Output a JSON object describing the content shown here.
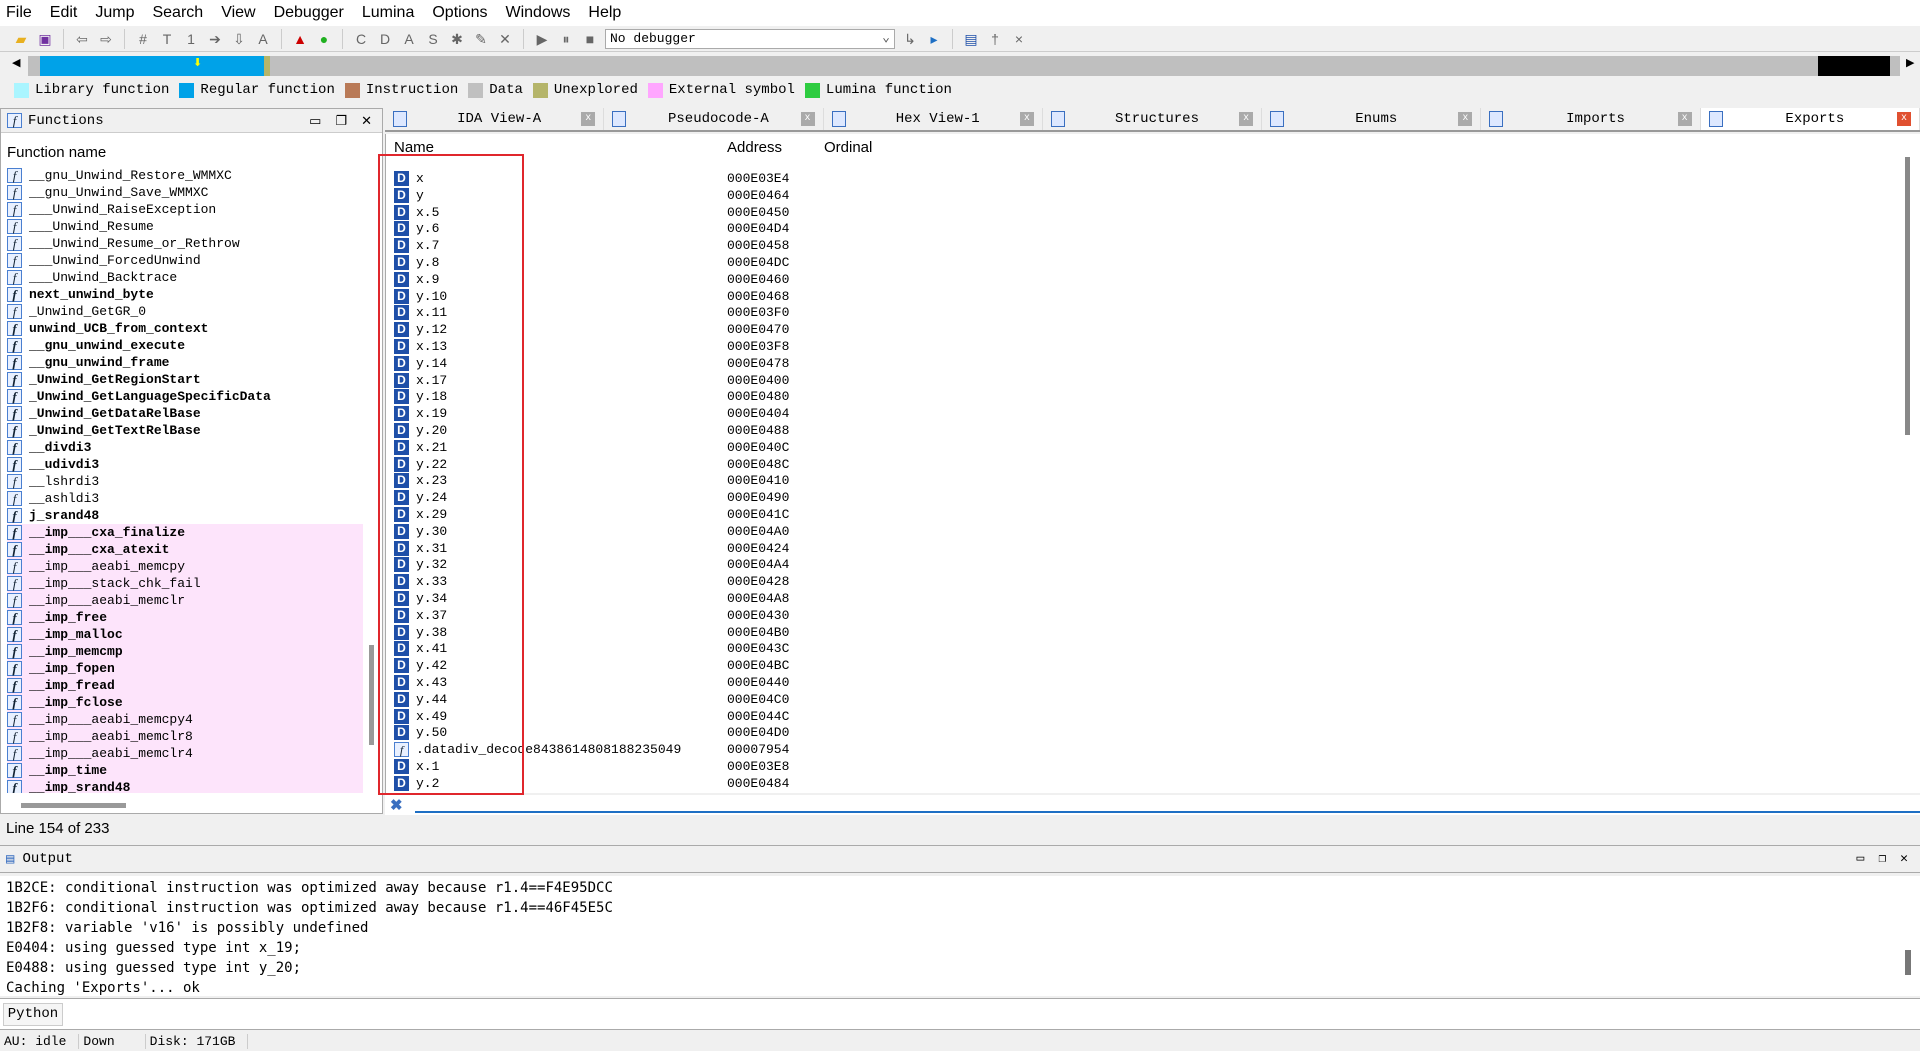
{
  "menu": [
    "File",
    "Edit",
    "Jump",
    "Search",
    "View",
    "Debugger",
    "Lumina",
    "Options",
    "Windows",
    "Help"
  ],
  "toolbar": {
    "debugger_select": "No debugger"
  },
  "legend": [
    {
      "label": "Library function",
      "color": "#aaf5ff"
    },
    {
      "label": "Regular function",
      "color": "#00a2e8"
    },
    {
      "label": "Instruction",
      "color": "#b97a57"
    },
    {
      "label": "Data",
      "color": "#c0c0c0"
    },
    {
      "label": "Unexplored",
      "color": "#b5b56a"
    },
    {
      "label": "External symbol",
      "color": "#ffa6ff"
    },
    {
      "label": "Lumina function",
      "color": "#2ecc40"
    }
  ],
  "functions": {
    "title": "Functions",
    "column": "Function name",
    "items": [
      {
        "name": "__gnu_Unwind_Restore_WMMXC"
      },
      {
        "name": "__gnu_Unwind_Save_WMMXC"
      },
      {
        "name": "___Unwind_RaiseException"
      },
      {
        "name": "___Unwind_Resume"
      },
      {
        "name": "___Unwind_Resume_or_Rethrow"
      },
      {
        "name": "___Unwind_ForcedUnwind"
      },
      {
        "name": "___Unwind_Backtrace"
      },
      {
        "name": "next_unwind_byte",
        "bold": true
      },
      {
        "name": "_Unwind_GetGR_0"
      },
      {
        "name": "unwind_UCB_from_context",
        "bold": true
      },
      {
        "name": "__gnu_unwind_execute",
        "bold": true
      },
      {
        "name": "__gnu_unwind_frame",
        "bold": true
      },
      {
        "name": "_Unwind_GetRegionStart",
        "bold": true
      },
      {
        "name": "_Unwind_GetLanguageSpecificData",
        "bold": true
      },
      {
        "name": "_Unwind_GetDataRelBase",
        "bold": true
      },
      {
        "name": "_Unwind_GetTextRelBase",
        "bold": true
      },
      {
        "name": "__divdi3",
        "bold": true
      },
      {
        "name": "__udivdi3",
        "bold": true
      },
      {
        "name": "__lshrdi3"
      },
      {
        "name": "__ashldi3"
      },
      {
        "name": "j_srand48",
        "bold": true
      },
      {
        "name": "__imp___cxa_finalize",
        "bold": true,
        "external": true
      },
      {
        "name": "__imp___cxa_atexit",
        "bold": true,
        "external": true
      },
      {
        "name": "__imp___aeabi_memcpy",
        "external": true
      },
      {
        "name": "__imp___stack_chk_fail",
        "external": true
      },
      {
        "name": "__imp___aeabi_memclr",
        "external": true
      },
      {
        "name": "__imp_free",
        "bold": true,
        "external": true
      },
      {
        "name": "__imp_malloc",
        "bold": true,
        "external": true
      },
      {
        "name": "__imp_memcmp",
        "bold": true,
        "external": true
      },
      {
        "name": "__imp_fopen",
        "bold": true,
        "external": true
      },
      {
        "name": "__imp_fread",
        "bold": true,
        "external": true
      },
      {
        "name": "__imp_fclose",
        "bold": true,
        "external": true
      },
      {
        "name": "__imp___aeabi_memcpy4",
        "external": true
      },
      {
        "name": "__imp___aeabi_memclr8",
        "external": true
      },
      {
        "name": "__imp___aeabi_memclr4",
        "external": true
      },
      {
        "name": "__imp_time",
        "bold": true,
        "external": true
      },
      {
        "name": "__imp_srand48",
        "bold": true,
        "external": true
      }
    ]
  },
  "tabs": [
    {
      "label": "IDA View-A"
    },
    {
      "label": "Pseudocode-A"
    },
    {
      "label": "Hex View-1"
    },
    {
      "label": "Structures"
    },
    {
      "label": "Enums"
    },
    {
      "label": "Imports"
    },
    {
      "label": "Exports",
      "active": true
    }
  ],
  "exports": {
    "columns": {
      "name": "Name",
      "address": "Address",
      "ordinal": "Ordinal"
    },
    "rows": [
      {
        "type": "D",
        "name": "x",
        "address": "000E03E4"
      },
      {
        "type": "D",
        "name": "y",
        "address": "000E0464"
      },
      {
        "type": "D",
        "name": "x.5",
        "address": "000E0450"
      },
      {
        "type": "D",
        "name": "y.6",
        "address": "000E04D4"
      },
      {
        "type": "D",
        "name": "x.7",
        "address": "000E0458"
      },
      {
        "type": "D",
        "name": "y.8",
        "address": "000E04DC"
      },
      {
        "type": "D",
        "name": "x.9",
        "address": "000E0460"
      },
      {
        "type": "D",
        "name": "y.10",
        "address": "000E0468"
      },
      {
        "type": "D",
        "name": "x.11",
        "address": "000E03F0"
      },
      {
        "type": "D",
        "name": "y.12",
        "address": "000E0470"
      },
      {
        "type": "D",
        "name": "x.13",
        "address": "000E03F8"
      },
      {
        "type": "D",
        "name": "y.14",
        "address": "000E0478"
      },
      {
        "type": "D",
        "name": "x.17",
        "address": "000E0400"
      },
      {
        "type": "D",
        "name": "y.18",
        "address": "000E0480"
      },
      {
        "type": "D",
        "name": "x.19",
        "address": "000E0404"
      },
      {
        "type": "D",
        "name": "y.20",
        "address": "000E0488"
      },
      {
        "type": "D",
        "name": "x.21",
        "address": "000E040C"
      },
      {
        "type": "D",
        "name": "y.22",
        "address": "000E048C"
      },
      {
        "type": "D",
        "name": "x.23",
        "address": "000E0410"
      },
      {
        "type": "D",
        "name": "y.24",
        "address": "000E0490"
      },
      {
        "type": "D",
        "name": "x.29",
        "address": "000E041C"
      },
      {
        "type": "D",
        "name": "y.30",
        "address": "000E04A0"
      },
      {
        "type": "D",
        "name": "x.31",
        "address": "000E0424"
      },
      {
        "type": "D",
        "name": "y.32",
        "address": "000E04A4"
      },
      {
        "type": "D",
        "name": "x.33",
        "address": "000E0428"
      },
      {
        "type": "D",
        "name": "y.34",
        "address": "000E04A8"
      },
      {
        "type": "D",
        "name": "x.37",
        "address": "000E0430"
      },
      {
        "type": "D",
        "name": "y.38",
        "address": "000E04B0"
      },
      {
        "type": "D",
        "name": "x.41",
        "address": "000E043C"
      },
      {
        "type": "D",
        "name": "y.42",
        "address": "000E04BC"
      },
      {
        "type": "D",
        "name": "x.43",
        "address": "000E0440"
      },
      {
        "type": "D",
        "name": "y.44",
        "address": "000E04C0"
      },
      {
        "type": "D",
        "name": "x.49",
        "address": "000E044C"
      },
      {
        "type": "D",
        "name": "y.50",
        "address": "000E04D0"
      },
      {
        "type": "f",
        "name": ".datadiv_decode8438614808188235049",
        "address": "00007954"
      },
      {
        "type": "D",
        "name": "x.1",
        "address": "000E03E8"
      },
      {
        "type": "D",
        "name": "y.2",
        "address": "000E0484"
      }
    ]
  },
  "line_info": "Line 154 of 233",
  "output": {
    "title": "Output",
    "lines": [
      "1B2CE: conditional instruction was optimized away because r1.4==F4E95DCC",
      "1B2F6: conditional instruction was optimized away because r1.4==46F45E5C",
      "1B2F8: variable 'v16' is possibly undefined",
      "E0404: using guessed type int x_19;",
      "E0488: using guessed type int y_20;",
      "Caching 'Exports'... ok"
    ]
  },
  "python_button": "Python",
  "status": {
    "au": "AU:  idle",
    "direction": "Down",
    "disk": "Disk: 171GB"
  },
  "highlight_color": "#e0262c"
}
